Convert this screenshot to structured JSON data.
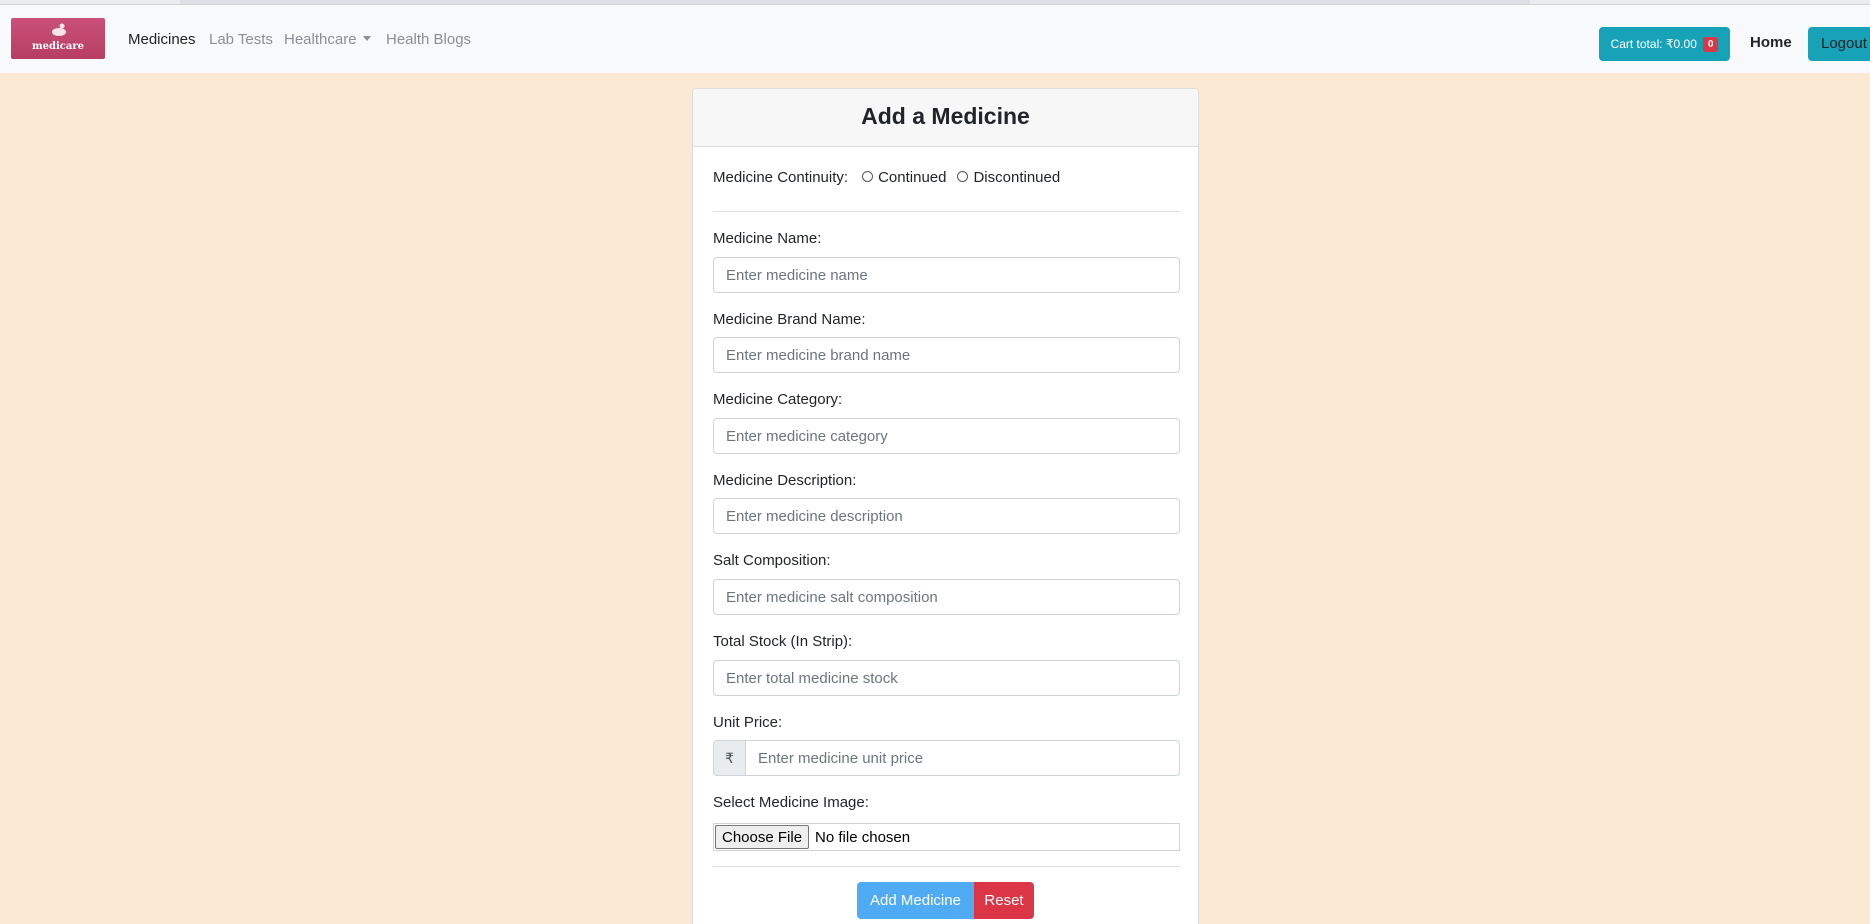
{
  "brand": {
    "logo_text": "medicare"
  },
  "nav": {
    "links": [
      "Medicines",
      "Lab Tests",
      "Healthcare",
      "Health Blogs"
    ],
    "cart_label": "Cart total: ₹0.00",
    "cart_count": "0",
    "home": "Home",
    "logout": "Logout"
  },
  "form": {
    "title": "Add a Medicine",
    "continuity": {
      "label": "Medicine Continuity:",
      "options": [
        "Continued",
        "Discontinued"
      ]
    },
    "fields": [
      {
        "label": "Medicine Name:",
        "placeholder": "Enter medicine name"
      },
      {
        "label": "Medicine Brand Name:",
        "placeholder": "Enter medicine brand name"
      },
      {
        "label": "Medicine Category:",
        "placeholder": "Enter medicine category"
      },
      {
        "label": "Medicine Description:",
        "placeholder": "Enter medicine description"
      },
      {
        "label": "Salt Composition:",
        "placeholder": "Enter medicine salt composition"
      },
      {
        "label": "Total Stock (In Strip):",
        "placeholder": "Enter total medicine stock"
      }
    ],
    "unit_price": {
      "label": "Unit Price:",
      "prefix": "₹",
      "placeholder": "Enter medicine unit price"
    },
    "image": {
      "label": "Select Medicine Image:",
      "button": "Choose File",
      "status": "No file chosen"
    },
    "buttons": {
      "submit": "Add Medicine",
      "reset": "Reset"
    }
  },
  "colors": {
    "page_background": "#fbe9d3",
    "navbar": "#f8f9fa",
    "info": "#17a2b8",
    "primary_button": "#50abf5",
    "danger": "#dc3545",
    "logo": "#c9517a"
  }
}
